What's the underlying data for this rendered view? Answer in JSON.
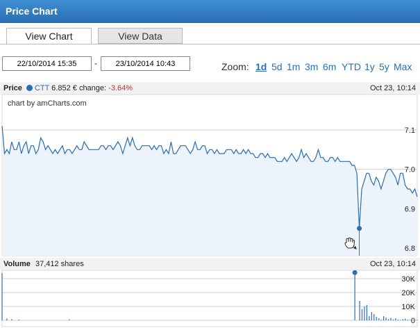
{
  "header": {
    "title": "Price Chart"
  },
  "tabs": [
    {
      "label": "View Chart",
      "active": true
    },
    {
      "label": "View Data",
      "active": false
    }
  ],
  "date_range": {
    "from": "22/10/2014 15:35",
    "separator": "-",
    "to": "23/10/2014 10:43"
  },
  "zoom": {
    "label": "Zoom:",
    "options": [
      "1d",
      "5d",
      "1m",
      "3m",
      "6m",
      "YTD",
      "1y",
      "5y",
      "Max"
    ],
    "selected": "1d"
  },
  "price_info": {
    "label": "Price",
    "symbol": "CTT",
    "value": "6.852 €",
    "change_label": "change:",
    "change": "-3.64%",
    "date": "Oct 23, 10:14"
  },
  "credit": "chart by amCharts.com",
  "volume_info": {
    "label": "Volume",
    "value": "37,412 shares",
    "date": "Oct 23, 10:14"
  },
  "colors": {
    "line": "#2a6cb6",
    "fill": "#edf3fa",
    "grid": "#cfcfcf",
    "header": "#2f7ac4",
    "negative": "#d9302c"
  },
  "chart_data": [
    {
      "type": "area",
      "ylim": [
        6.8,
        7.1
      ],
      "yticks": [
        "7.1",
        "7.0",
        "6.9",
        "6.8"
      ],
      "ytick_values": [
        7.1,
        7.0,
        6.9,
        6.8
      ],
      "grid": true,
      "values": [
        7.11,
        7.04,
        7.05,
        7.04,
        7.07,
        7.05,
        7.05,
        7.07,
        7.04,
        7.06,
        7.07,
        7.04,
        7.06,
        7.06,
        7.04,
        7.05,
        7.08,
        7.07,
        7.05,
        7.06,
        7.05,
        7.04,
        7.05,
        7.04,
        7.05,
        7.06,
        7.04,
        7.05,
        7.05,
        7.04,
        7.05,
        7.06,
        7.05,
        7.05,
        7.07,
        7.06,
        7.05,
        7.05,
        7.05,
        7.05,
        7.05,
        7.06,
        7.06,
        7.05,
        7.06,
        7.06,
        7.05,
        7.06,
        7.07,
        7.06,
        7.04,
        7.06,
        7.08,
        7.06,
        7.08,
        7.06,
        7.05,
        7.05,
        7.06,
        7.06,
        7.06,
        7.06,
        7.05,
        7.06,
        7.05,
        7.06,
        7.06,
        7.04,
        7.05,
        7.04,
        7.07,
        7.04,
        7.04,
        7.05,
        7.06,
        7.06,
        7.06,
        7.05,
        7.04,
        7.05,
        7.07,
        7.05,
        7.05,
        7.06,
        7.06,
        7.04,
        7.05,
        7.05,
        7.04,
        7.05,
        7.04,
        7.04,
        7.04,
        7.05,
        7.05,
        7.05,
        7.04,
        7.05,
        7.04,
        7.04,
        7.05,
        7.04,
        7.05,
        7.04,
        7.04,
        7.03,
        7.03,
        7.04,
        7.04,
        7.03,
        7.04,
        7.03,
        7.03,
        7.03,
        7.02,
        7.02,
        7.02,
        7.03,
        7.02,
        7.03,
        7.04,
        7.03,
        7.02,
        7.03,
        7.05,
        7.03,
        7.04,
        7.03,
        7.02,
        7.02,
        7.03,
        7.05,
        7.03,
        7.03,
        7.02,
        7.02,
        7.03,
        7.03,
        7.02,
        7.03,
        7.02,
        7.02,
        7.02,
        7.02,
        7.02,
        7.01,
        7.01,
        6.99,
        6.85,
        6.95,
        6.97,
        6.99,
        6.99,
        6.97,
        6.96,
        6.98,
        6.97,
        6.95,
        6.97,
        6.99,
        7.0,
        7.0,
        6.99,
        6.98,
        6.96,
        6.99,
        6.99,
        6.96,
        6.95,
        6.95,
        6.94,
        6.95,
        6.93
      ],
      "highlight": {
        "value": 6.85
      }
    },
    {
      "type": "bar",
      "ylim": [
        0,
        35000
      ],
      "yticks": [
        "30K",
        "20K",
        "10K",
        "0"
      ],
      "ytick_values": [
        30000,
        20000,
        10000,
        0
      ],
      "grid": true,
      "values": [
        34000,
        0,
        1400,
        0,
        800,
        0,
        0,
        500,
        0,
        0,
        0,
        0,
        0,
        0,
        0,
        0,
        0,
        0,
        0,
        0,
        0,
        0,
        0,
        0,
        0,
        0,
        0,
        0,
        700,
        0,
        0,
        0,
        0,
        0,
        0,
        0,
        0,
        0,
        0,
        0,
        0,
        0,
        0,
        0,
        0,
        0,
        0,
        0,
        0,
        0,
        0,
        0,
        0,
        0,
        0,
        0,
        0,
        0,
        0,
        0,
        0,
        0,
        0,
        0,
        0,
        0,
        0,
        0,
        0,
        0,
        0,
        0,
        0,
        0,
        0,
        0,
        0,
        0,
        0,
        0,
        0,
        0,
        0,
        0,
        0,
        0,
        0,
        0,
        0,
        0,
        0,
        0,
        0,
        0,
        0,
        0,
        0,
        0,
        0,
        0,
        0,
        0,
        0,
        0,
        0,
        0,
        0,
        0,
        0,
        0,
        0,
        0,
        0,
        0,
        0,
        0,
        0,
        0,
        0,
        0,
        0,
        0,
        0,
        0,
        0,
        0,
        0,
        0,
        0,
        0,
        0,
        0,
        0,
        0,
        0,
        0,
        0,
        0,
        0,
        0,
        0,
        0,
        0,
        0,
        0,
        0,
        0,
        34400,
        0,
        14000,
        8000,
        10000,
        11000,
        3000,
        6000,
        4500,
        2500,
        1500,
        600,
        3000,
        2000,
        900,
        1800,
        600,
        1500,
        500,
        300,
        900,
        1200,
        500,
        300,
        200,
        300,
        400
      ],
      "highlight": {
        "value": 34400
      }
    }
  ]
}
